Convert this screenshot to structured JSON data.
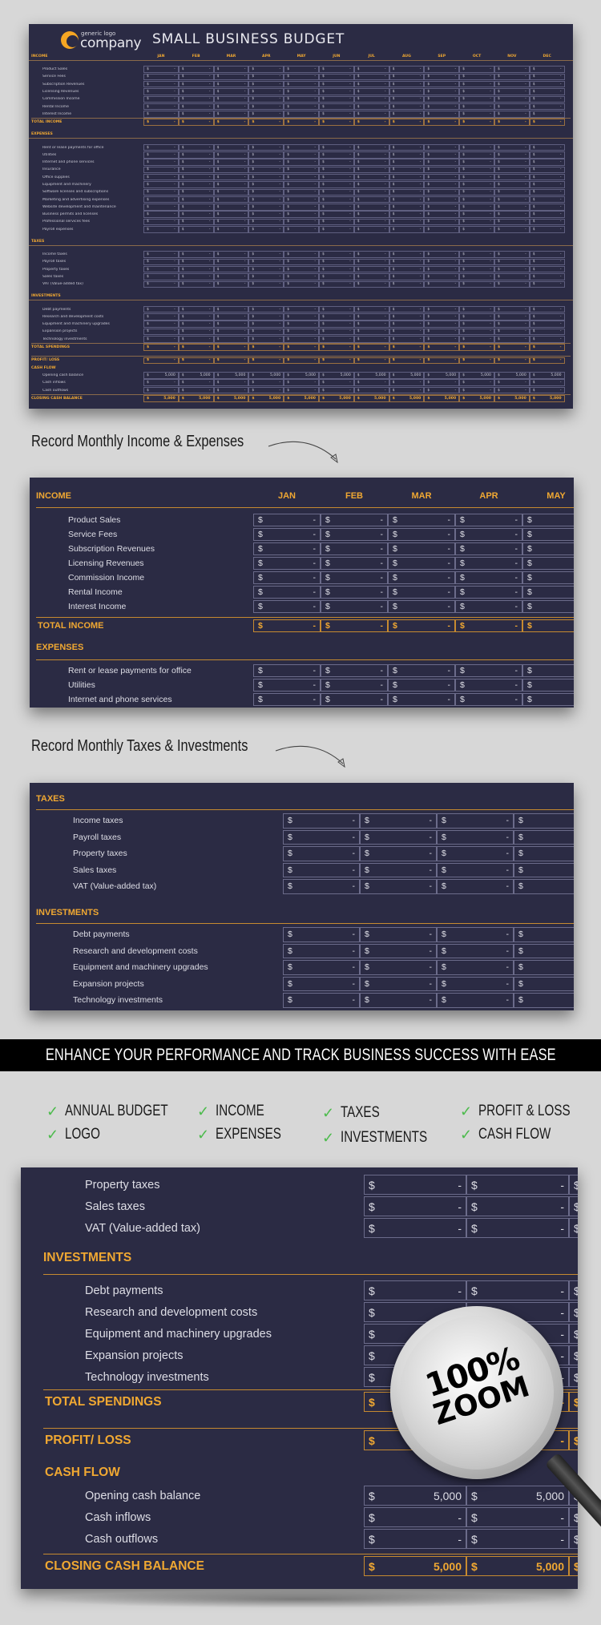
{
  "sheet1": {
    "logo": {
      "small": "generic logo",
      "big": "company"
    },
    "title": "SMALL BUSINESS BUDGET",
    "months": [
      "JAN",
      "FEB",
      "MAR",
      "APR",
      "MAY",
      "JUN",
      "JUL",
      "AUG",
      "SEP",
      "OCT",
      "NOV",
      "DEC"
    ],
    "currency": "$",
    "empty": "-",
    "sections": [
      {
        "title": "INCOME",
        "rows": [
          "Product Sales",
          "Service Fees",
          "Subscription Revenues",
          "Licensing Revenues",
          "Commission Income",
          "Rental Income",
          "Interest Income"
        ],
        "total": "TOTAL INCOME"
      },
      {
        "title": "EXPENSES",
        "rows": [
          "Rent or lease payments for office",
          "Utilities",
          "Internet and phone services",
          "Insurance",
          "Office supplies",
          "Equipment and machinery",
          "Software licenses and subscriptions",
          "Marketing and advertising expenses",
          "Website development and maintenance",
          "Business permits and licenses",
          "Professional services fees",
          "Payroll expenses"
        ]
      },
      {
        "title": "TAXES",
        "rows": [
          "Income taxes",
          "Payroll taxes",
          "Property taxes",
          "Sales taxes",
          "VAT (Value-added tax)"
        ]
      },
      {
        "title": "INVESTMENTS",
        "rows": [
          "Debt payments",
          "Research and development costs",
          "Equipment and machinery upgrades",
          "Expansion projects",
          "Technology investments"
        ],
        "total": "TOTAL SPENDINGS"
      }
    ],
    "profit_loss": "PROFIT/ LOSS",
    "cash_flow": {
      "title": "CASH FLOW",
      "rows": [
        {
          "label": "Opening cash balance",
          "value": "5,000"
        },
        {
          "label": "Cash inflows",
          "value": "-"
        },
        {
          "label": "Cash outflows",
          "value": "-"
        }
      ],
      "closing_label": "CLOSING CASH BALANCE",
      "closing_value": "5,000"
    }
  },
  "captions": {
    "income_expenses": "Record Monthly Income & Expenses",
    "taxes_investments": "Record Monthly Taxes & Investments"
  },
  "sheet2": {
    "months": [
      "JAN",
      "FEB",
      "MAR",
      "APR",
      "MAY"
    ],
    "income_title": "INCOME",
    "income_rows": [
      "Product Sales",
      "Service Fees",
      "Subscription Revenues",
      "Licensing Revenues",
      "Commission Income",
      "Rental Income",
      "Interest Income"
    ],
    "total_income": "TOTAL INCOME",
    "expenses_title": "EXPENSES",
    "expense_rows": [
      "Rent or lease payments for office",
      "Utilities",
      "Internet and phone services"
    ]
  },
  "sheet3": {
    "taxes_title": "TAXES",
    "tax_rows": [
      "Income taxes",
      "Payroll taxes",
      "Property taxes",
      "Sales taxes",
      "VAT (Value-added tax)"
    ],
    "investments_title": "INVESTMENTS",
    "investment_rows": [
      "Debt payments",
      "Research and development costs",
      "Equipment and machinery upgrades",
      "Expansion projects",
      "Technology investments"
    ]
  },
  "banner": "ENHANCE YOUR PERFORMANCE AND TRACK BUSINESS SUCCESS WITH EASE",
  "features": [
    "ANNUAL BUDGET",
    "LOGO",
    "INCOME",
    "EXPENSES",
    "TAXES",
    "INVESTMENTS",
    "PROFIT & LOSS",
    "CASH FLOW"
  ],
  "feature_check_color": "#4cbb4c",
  "sheet4": {
    "tax_rows": [
      "Property taxes",
      "Sales taxes",
      "VAT (Value-added tax)"
    ],
    "investments_title": "INVESTMENTS",
    "investment_rows": [
      "Debt payments",
      "Research and development costs",
      "Equipment and machinery upgrades",
      "Expansion projects",
      "Technology investments"
    ],
    "total_spendings": "TOTAL SPENDINGS",
    "profit_loss": "PROFIT/ LOSS",
    "cash_flow_title": "CASH FLOW",
    "cash_rows": [
      {
        "label": "Opening cash balance",
        "value": "5,000"
      },
      {
        "label": "Cash inflows",
        "value": "-"
      },
      {
        "label": "Cash outflows",
        "value": "-"
      }
    ],
    "closing_label": "CLOSING CASH BALANCE",
    "closing_value": "5,000"
  },
  "magnifier": {
    "line1": "100%",
    "line2": "ZOOM"
  },
  "colors": {
    "sheet_bg": "#2b2b44",
    "accent": "#f0a832",
    "page_bg": "#d7d7d7"
  }
}
